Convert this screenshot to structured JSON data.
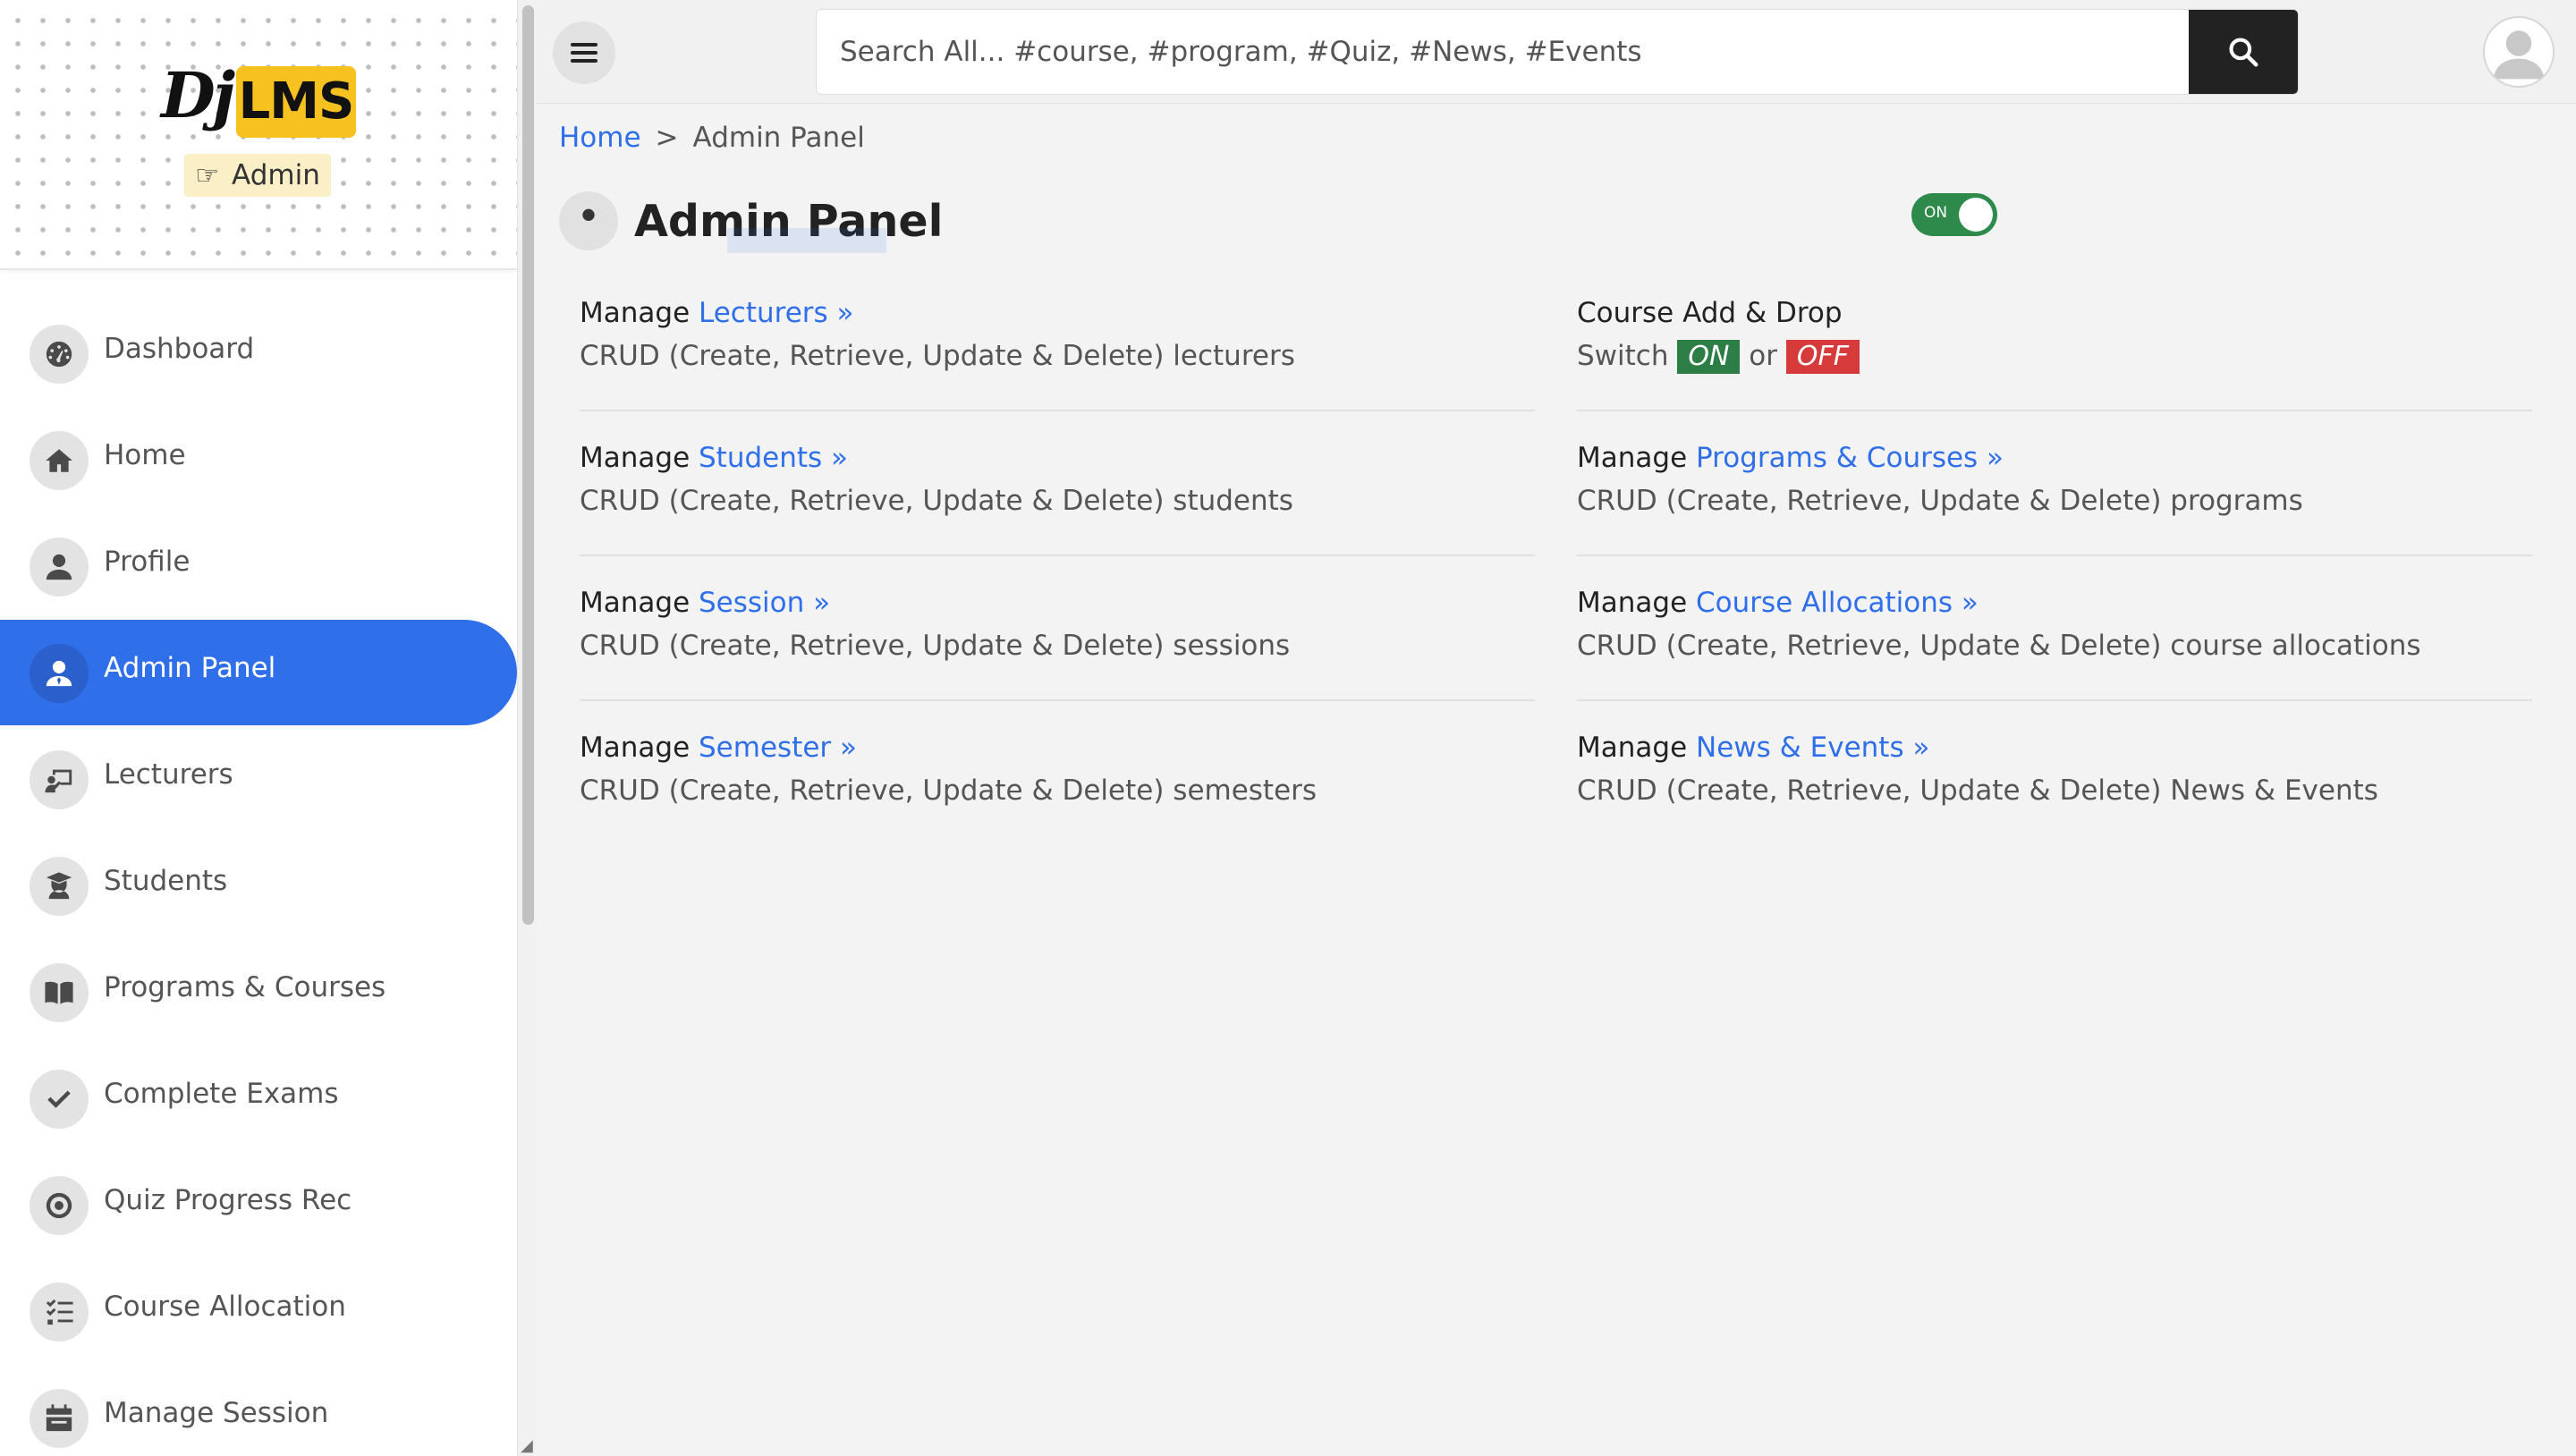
{
  "brand": {
    "logo_dj": "Dj",
    "logo_lms": "LMS",
    "role": "Admin"
  },
  "sidebar": {
    "items": [
      {
        "label": "Dashboard",
        "icon": "dashboard-icon",
        "active": false
      },
      {
        "label": "Home",
        "icon": "home-icon",
        "active": false
      },
      {
        "label": "Profile",
        "icon": "user-icon",
        "active": false
      },
      {
        "label": "Admin Panel",
        "icon": "admin-user-icon",
        "active": true
      },
      {
        "label": "Lecturers",
        "icon": "chalkboard-teacher-icon",
        "active": false
      },
      {
        "label": "Students",
        "icon": "graduate-icon",
        "active": false
      },
      {
        "label": "Programs & Courses",
        "icon": "book-open-icon",
        "active": false
      },
      {
        "label": "Complete Exams",
        "icon": "check-icon",
        "active": false
      },
      {
        "label": "Quiz Progress Rec",
        "icon": "record-icon",
        "active": false
      },
      {
        "label": "Course Allocation",
        "icon": "tasks-icon",
        "active": false
      },
      {
        "label": "Manage Session",
        "icon": "calendar-icon",
        "active": false
      }
    ]
  },
  "topbar": {
    "search_placeholder": "Search All... #course, #program, #Quiz, #News, #Events"
  },
  "breadcrumb": {
    "home": "Home",
    "separator": ">",
    "current": "Admin Panel"
  },
  "page": {
    "title": "Admin Panel"
  },
  "cards": {
    "lecturers": {
      "prefix": "Manage",
      "link": "Lecturers »",
      "desc": "CRUD (Create, Retrieve, Update & Delete) lecturers"
    },
    "students": {
      "prefix": "Manage",
      "link": "Students »",
      "desc": "CRUD (Create, Retrieve, Update & Delete) students"
    },
    "session": {
      "prefix": "Manage",
      "link": "Session »",
      "desc": "CRUD (Create, Retrieve, Update & Delete) sessions"
    },
    "semester": {
      "prefix": "Manage",
      "link": "Semester »",
      "desc": "CRUD (Create, Retrieve, Update & Delete) semesters"
    },
    "add_drop": {
      "title": "Course Add & Drop",
      "switch_label": "Switch",
      "on_label": "ON",
      "or_label": "or",
      "off_label": "OFF",
      "toggle_text": "ON",
      "toggle_on": true
    },
    "programs": {
      "prefix": "Manage",
      "link": "Programs & Courses »",
      "desc": "CRUD (Create, Retrieve, Update & Delete) programs"
    },
    "allocations": {
      "prefix": "Manage",
      "link": "Course Allocations »",
      "desc": "CRUD (Create, Retrieve, Update & Delete) course allocations"
    },
    "news": {
      "prefix": "Manage",
      "link": "News & Events »",
      "desc": "CRUD (Create, Retrieve, Update & Delete) News & Events"
    }
  },
  "colors": {
    "accent": "#2f6fea",
    "on_green": "#2d7d46",
    "off_red": "#d63a3a",
    "logo_yellow": "#f7c11f"
  }
}
